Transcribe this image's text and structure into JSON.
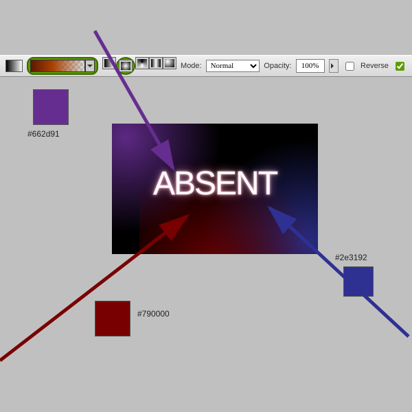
{
  "toolbar": {
    "mode_label": "Mode:",
    "mode_value": "Normal",
    "opacity_label": "Opacity:",
    "opacity_value": "100%",
    "reverse_label": "Reverse",
    "reverse_checked": false,
    "dither_checked": true
  },
  "artwork": {
    "text": "ABSENT"
  },
  "swatches": {
    "purple": "#662d91",
    "red": "#790000",
    "blue": "#2e3192"
  }
}
